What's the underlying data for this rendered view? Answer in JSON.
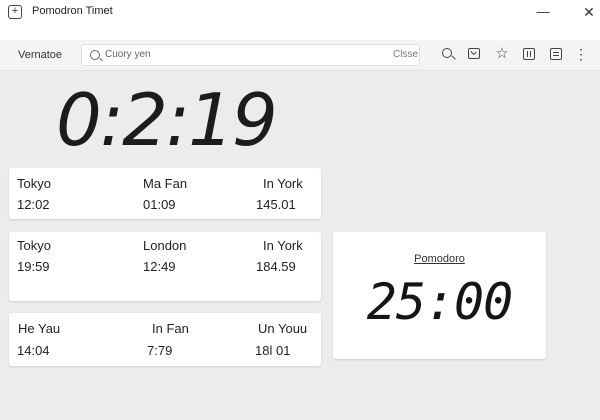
{
  "window": {
    "title": "Pomodron Timet",
    "app_icon": "+",
    "minimize_label": "—",
    "close_label": "✕"
  },
  "toolbar": {
    "label": "Vernatoe",
    "search": {
      "value": "Cuory yen",
      "close_label": "Clsse"
    },
    "icons": [
      "search-icon",
      "inbox-check-icon",
      "star-icon",
      "columns-icon",
      "panel-icon",
      "more-vertical-icon"
    ],
    "star_glyph": "☆",
    "more_glyph": "⋮"
  },
  "main_clock": {
    "time": "0:2:19"
  },
  "world_clocks": [
    {
      "cities": [
        "Tokyo",
        "Ma Fan",
        "In York"
      ],
      "times": [
        "12:02",
        "01:09",
        "145.01"
      ]
    },
    {
      "cities": [
        "Tokyo",
        "London",
        "In York"
      ],
      "times": [
        "19:59",
        "12:49",
        "184.59"
      ]
    },
    {
      "cities": [
        "He Yau",
        "In Fan",
        "Un Youu"
      ],
      "times": [
        "14:04",
        "7:79",
        "18l 01"
      ]
    }
  ],
  "pomodoro": {
    "label": "Pomodoro",
    "time": "25:00"
  }
}
